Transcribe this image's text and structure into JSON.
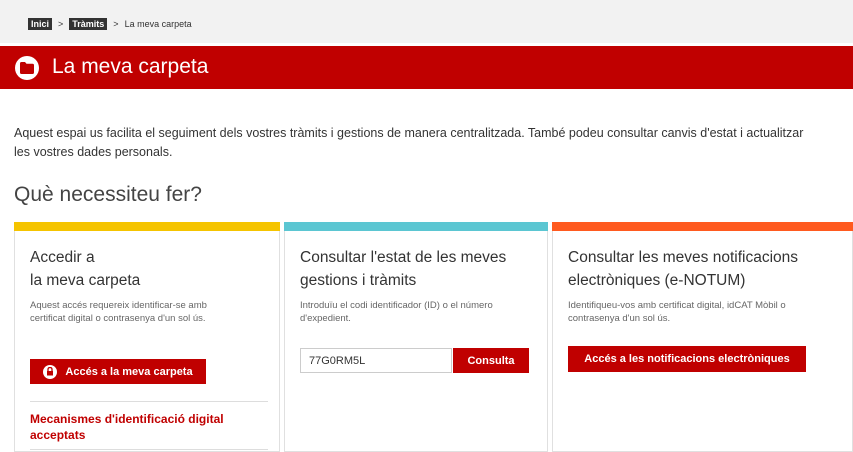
{
  "breadcrumb": {
    "items": [
      {
        "label": "Inici"
      },
      {
        "label": "Tràmits"
      },
      {
        "label": "La meva carpeta"
      }
    ],
    "separator": ">"
  },
  "header": {
    "title": "La meva carpeta",
    "icon": "folder-icon"
  },
  "intro": {
    "line1": "Aquest espai us facilita el seguiment dels vostres tràmits i gestions de manera centralitzada. També podeu consultar canvis d'estat i actualitzar",
    "line2": "les vostres dades personals."
  },
  "section": {
    "title": "Què necessiteu fer?"
  },
  "panels": [
    {
      "accent": "#f5c400",
      "title_line1": "Accedir a",
      "title_line2": "la meva carpeta",
      "desc_line1": "Aquest accés requereix identificar-se amb",
      "desc_line2": "certificat digital o contrasenya d'un sol ús.",
      "button": "Accés a la meva carpeta",
      "link_line1": "Mecanismes d'identificació digital",
      "link_line2": "acceptats"
    },
    {
      "accent": "#5bc6d2",
      "title_line1": "Consultar l'estat de les meves",
      "title_line2": "gestions i tràmits",
      "desc_line1": "Introduïu el codi identificador (ID) o el número",
      "desc_line2": "d'expedient.",
      "input_value": "77G0RM5L",
      "button": "Consulta"
    },
    {
      "accent": "#ff5a1f",
      "title_line1": "Consultar les meves notificacions",
      "title_line2": "electròniques (e-NOTUM)",
      "desc_line1": "Identifiqueu-vos amb certificat digital, idCAT Mòbil o",
      "desc_line2": "contrasenya d'un sol ús.",
      "button": "Accés a les notificacions electròniques"
    }
  ],
  "colors": {
    "brand": "#c00000"
  }
}
